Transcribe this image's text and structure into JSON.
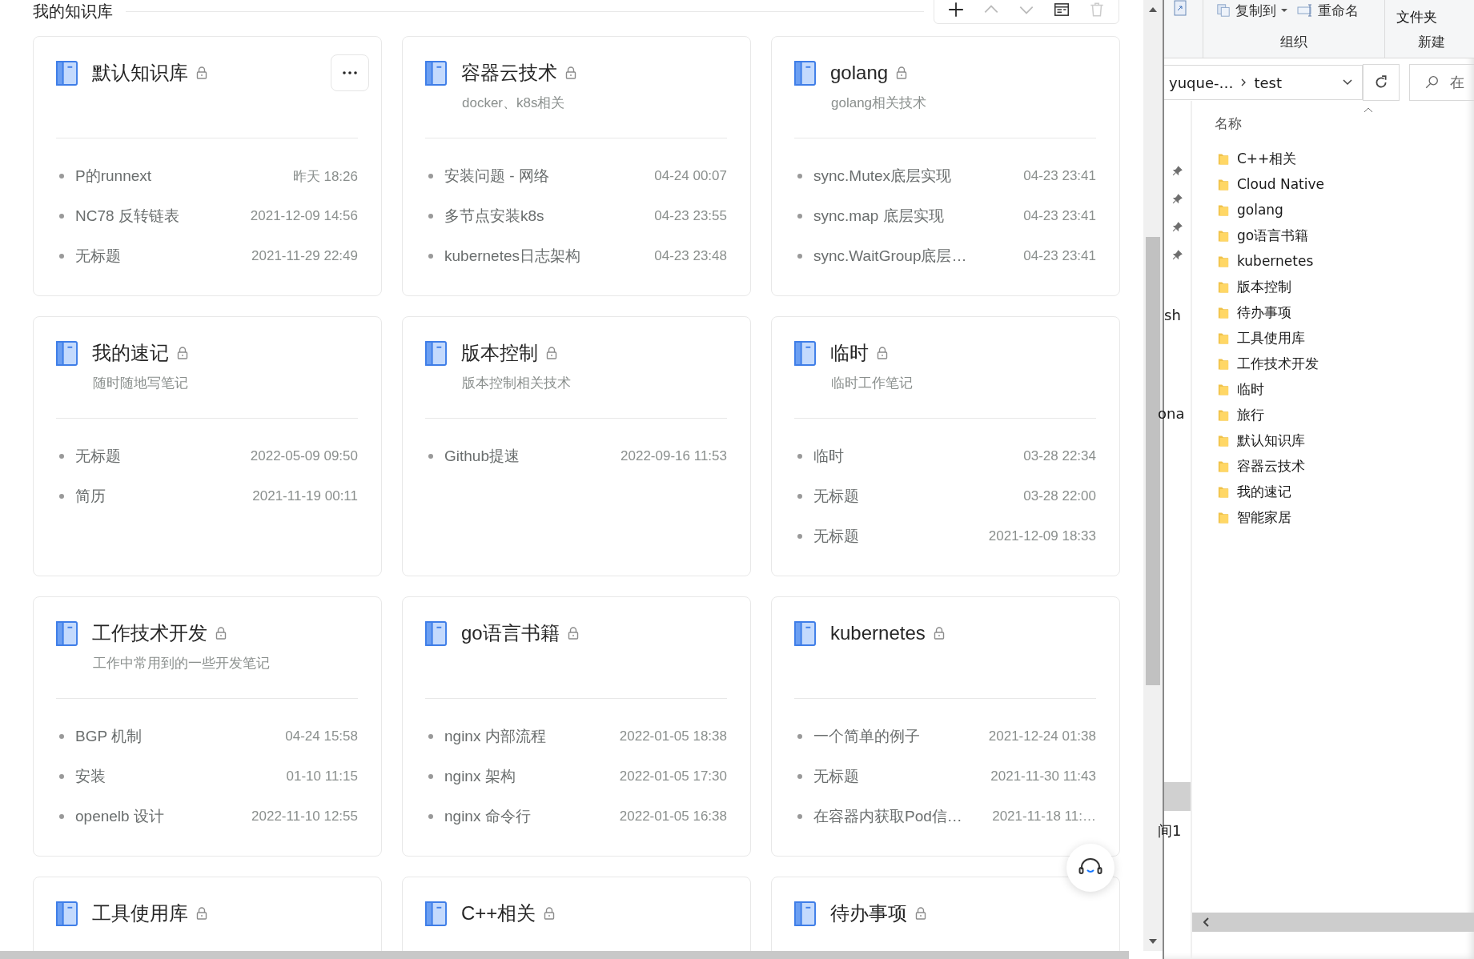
{
  "library": {
    "title": "我的知识库",
    "cards": [
      {
        "title": "默认知识库",
        "hovered": true,
        "items": [
          {
            "title": "P的runnext",
            "time": "昨天 18:26"
          },
          {
            "title": "NC78 反转链表",
            "time": "2021-12-09 14:56"
          },
          {
            "title": "无标题",
            "time": "2021-11-29 22:49"
          }
        ]
      },
      {
        "title": "容器云技术",
        "description": "docker、k8s相关",
        "hovered": false,
        "items": [
          {
            "title": "安装问题 - 网络",
            "time": "04-24 00:07"
          },
          {
            "title": "多节点安装k8s",
            "time": "04-23 23:55"
          },
          {
            "title": "kubernetes日志架构",
            "time": "04-23 23:48"
          }
        ]
      },
      {
        "title": "golang",
        "description": "golang相关技术",
        "hovered": false,
        "items": [
          {
            "title": "sync.Mutex底层实现",
            "time": "04-23 23:41"
          },
          {
            "title": "sync.map 底层实现",
            "time": "04-23 23:41"
          },
          {
            "title": "sync.WaitGroup底层…",
            "time": "04-23 23:41"
          }
        ]
      },
      {
        "title": "我的速记",
        "description": "随时随地写笔记",
        "hovered": false,
        "items": [
          {
            "title": "无标题",
            "time": "2022-05-09 09:50"
          },
          {
            "title": "简历",
            "time": "2021-11-19 00:11"
          }
        ]
      },
      {
        "title": "版本控制",
        "description": "版本控制相关技术",
        "hovered": false,
        "items": [
          {
            "title": "Github提速",
            "time": "2022-09-16 11:53"
          }
        ]
      },
      {
        "title": "临时",
        "description": "临时工作笔记",
        "hovered": false,
        "items": [
          {
            "title": "临时",
            "time": "03-28 22:34"
          },
          {
            "title": "无标题",
            "time": "03-28 22:00"
          },
          {
            "title": "无标题",
            "time": "2021-12-09 18:33"
          }
        ]
      },
      {
        "title": "工作技术开发",
        "description": "工作中常用到的一些开发笔记",
        "hovered": false,
        "items": [
          {
            "title": "BGP 机制",
            "time": "04-24 15:58"
          },
          {
            "title": "安装",
            "time": "01-10 11:15"
          },
          {
            "title": "openelb 设计",
            "time": "2022-11-10 12:55"
          }
        ]
      },
      {
        "title": "go语言书籍",
        "hovered": false,
        "items": [
          {
            "title": "nginx 内部流程",
            "time": "2022-01-05 18:38"
          },
          {
            "title": "nginx 架构",
            "time": "2022-01-05 17:30"
          },
          {
            "title": "nginx 命令行",
            "time": "2022-01-05 16:38"
          }
        ]
      },
      {
        "title": "kubernetes",
        "hovered": false,
        "items": [
          {
            "title": "一个简单的例子",
            "time": "2021-12-24 01:38"
          },
          {
            "title": "无标题",
            "time": "2021-11-30 11:43"
          },
          {
            "title": "在容器内获取Pod信…",
            "time": "2021-11-18 11:…"
          }
        ]
      },
      {
        "title": "工具使用库",
        "hovered": false
      },
      {
        "title": "C++相关",
        "hovered": false
      },
      {
        "title": "待办事项",
        "hovered": false
      }
    ]
  },
  "explorer": {
    "ribbon": {
      "buttons": [
        "复制到",
        "重命名",
        "文件夹"
      ],
      "groups": [
        "组织",
        "新建"
      ]
    },
    "breadcrumb": [
      "yuque-…",
      "test"
    ],
    "search": {
      "placeholder": "在"
    },
    "nav_fragments": [
      "sh",
      "ona",
      "间1"
    ],
    "column": "名称",
    "folders": [
      "C++相关",
      "Cloud Native",
      "golang",
      "go语言书籍",
      "kubernetes",
      "版本控制",
      "待办事项",
      "工具使用库",
      "工作技术开发",
      "临时",
      "旅行",
      "默认知识库",
      "容器云技术",
      "我的速记",
      "智能家居"
    ]
  }
}
